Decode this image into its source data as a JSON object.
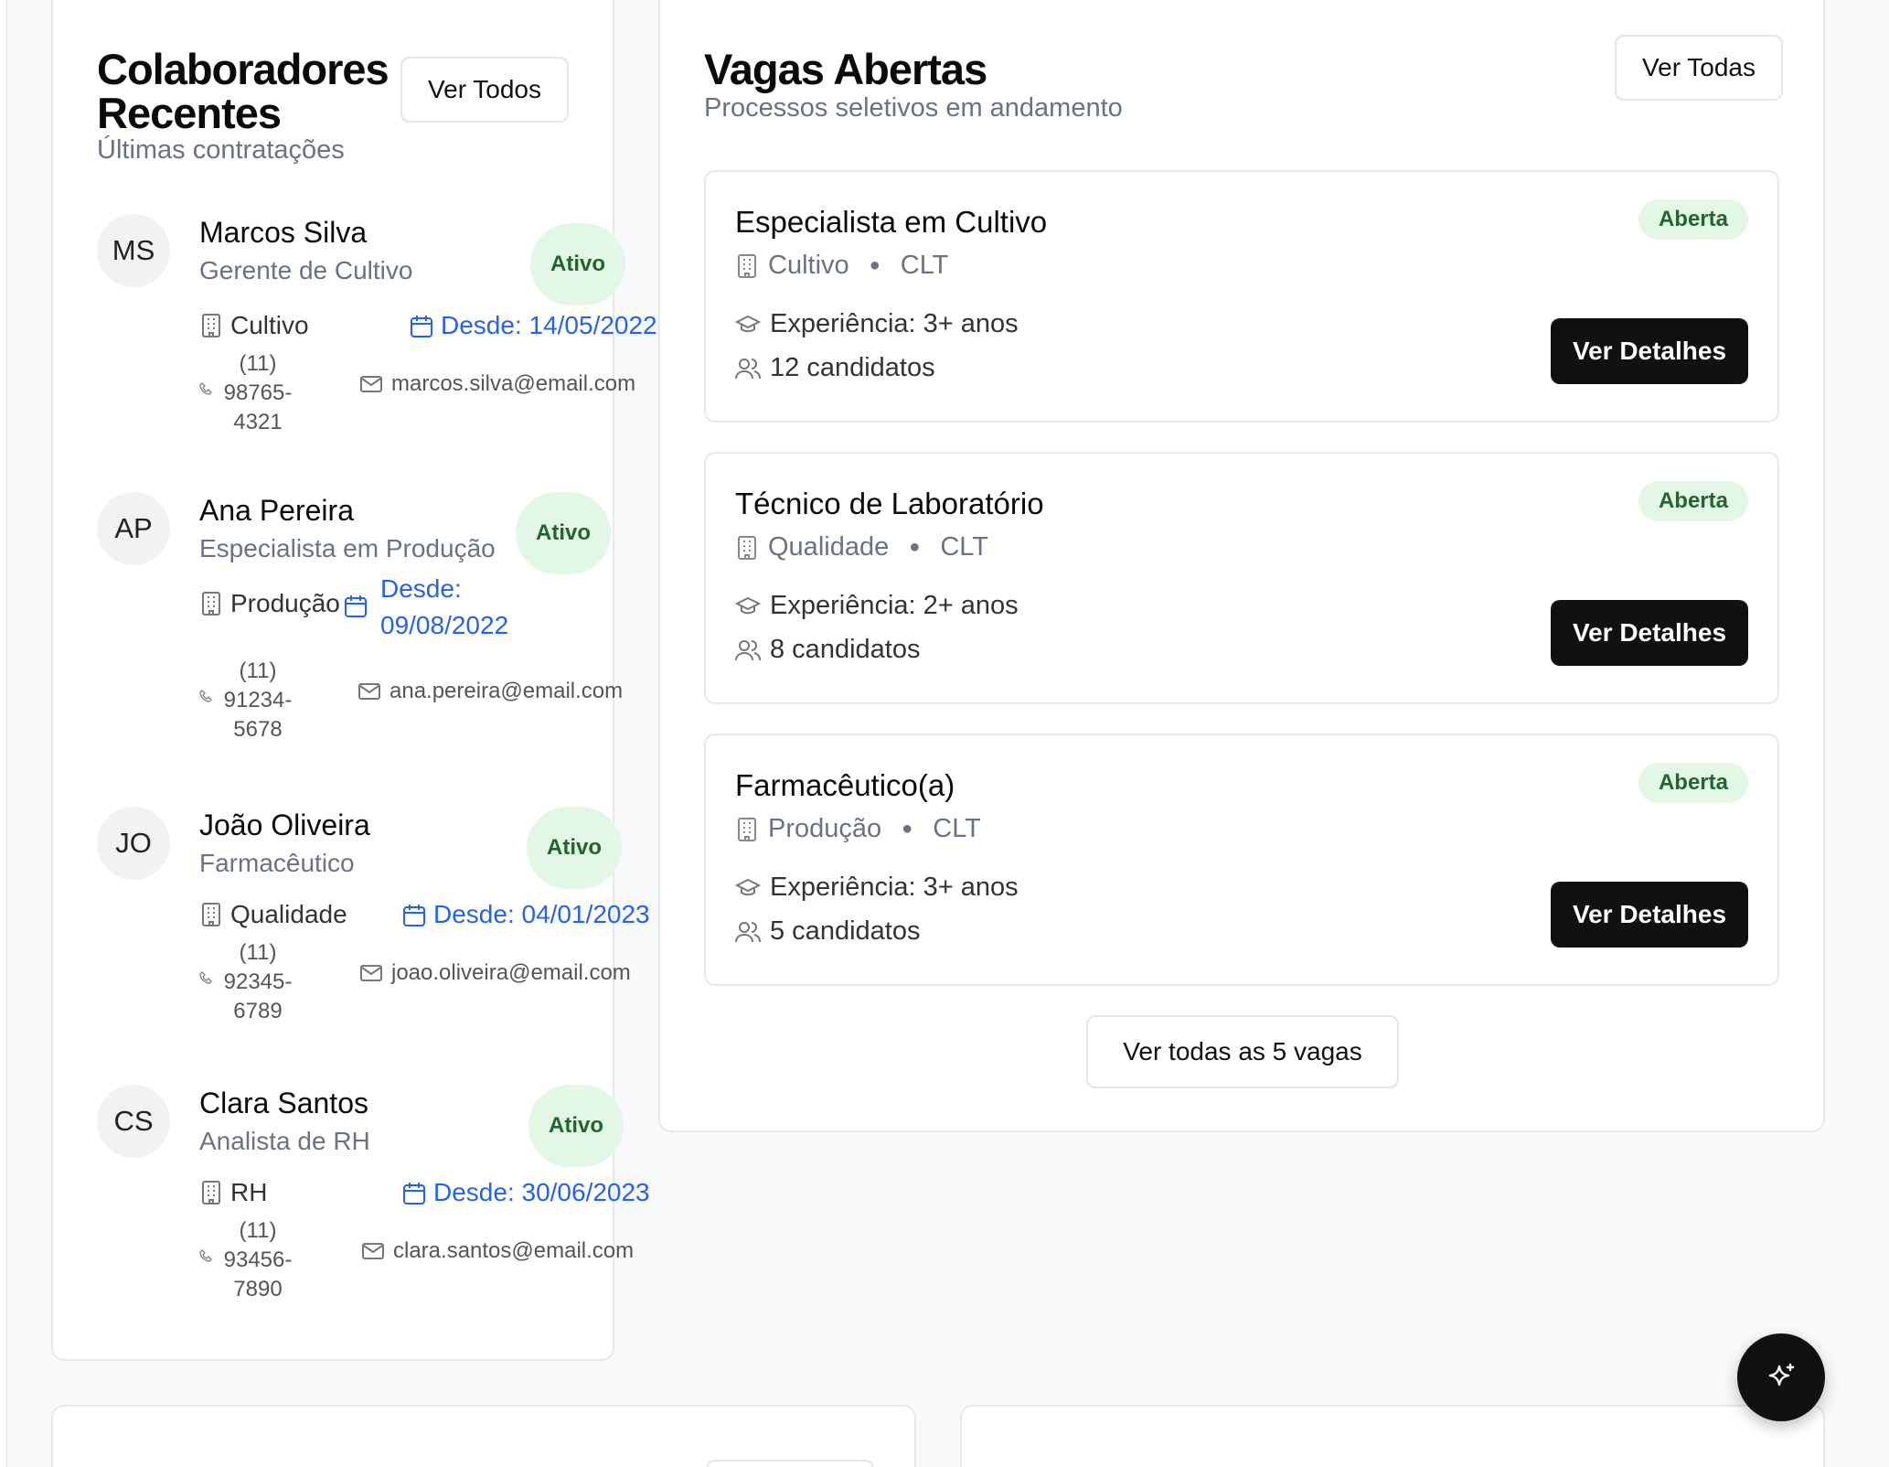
{
  "collaborators_card": {
    "title_line1": "Colaboradores",
    "title_line2": "Recentes",
    "subtitle": "Últimas contratações",
    "view_all_label": "Ver Todos",
    "people": [
      {
        "initials": "MS",
        "name": "Marcos Silva",
        "role": "Gerente de Cultivo",
        "status": "Ativo",
        "department": "Cultivo",
        "since": "Desde: 14/05/2022",
        "phone_l1": "(11)",
        "phone_l2": "98765-",
        "phone_l3": "4321",
        "email": "marcos.silva@email.com"
      },
      {
        "initials": "AP",
        "name": "Ana Pereira",
        "role": "Especialista em Produção",
        "status": "Ativo",
        "department": "Produção",
        "since_l1": "Desde:",
        "since_l2": "09/08/2022",
        "phone_l1": "(11)",
        "phone_l2": "91234-",
        "phone_l3": "5678",
        "email": "ana.pereira@email.com"
      },
      {
        "initials": "JO",
        "name": "João Oliveira",
        "role": "Farmacêutico",
        "status": "Ativo",
        "department": "Qualidade",
        "since": "Desde: 04/01/2023",
        "phone_l1": "(11)",
        "phone_l2": "92345-",
        "phone_l3": "6789",
        "email": "joao.oliveira@email.com"
      },
      {
        "initials": "CS",
        "name": "Clara Santos",
        "role": "Analista de RH",
        "status": "Ativo",
        "department": "RH",
        "since": "Desde: 30/06/2023",
        "phone_l1": "(11)",
        "phone_l2": "93456-",
        "phone_l3": "7890",
        "email": "clara.santos@email.com"
      }
    ]
  },
  "jobs_card": {
    "title": "Vagas Abertas",
    "subtitle": "Processos seletivos em andamento",
    "view_all_label": "Ver Todas",
    "jobs": [
      {
        "title": "Especialista em Cultivo",
        "status": "Aberta",
        "department": "Cultivo",
        "contract": "CLT",
        "experience": "Experiência: 3+ anos",
        "candidates": "12 candidatos",
        "action": "Ver Detalhes"
      },
      {
        "title": "Técnico de Laboratório",
        "status": "Aberta",
        "department": "Qualidade",
        "contract": "CLT",
        "experience": "Experiência: 2+ anos",
        "candidates": "8 candidatos",
        "action": "Ver Detalhes"
      },
      {
        "title": "Farmacêutico(a)",
        "status": "Aberta",
        "department": "Produção",
        "contract": "CLT",
        "experience": "Experiência: 3+ anos",
        "candidates": "5 candidatos",
        "action": "Ver Detalhes"
      }
    ],
    "footer_button": "Ver todas as 5 vagas"
  },
  "colors": {
    "accent_blue": "#2563eb",
    "status_green_bg": "#e3f7e6",
    "status_green_text": "#22652f",
    "primary_button": "#111111"
  },
  "icons": [
    "building-icon",
    "calendar-icon",
    "phone-icon",
    "mail-icon",
    "graduation-cap-icon",
    "users-icon",
    "sparkles-icon"
  ]
}
